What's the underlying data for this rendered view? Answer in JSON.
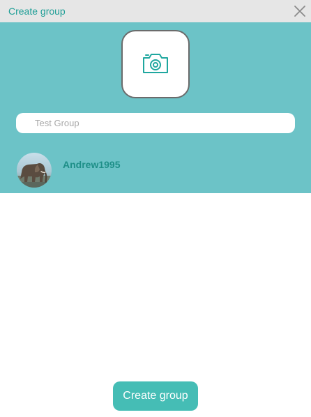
{
  "window": {
    "title": "Create group",
    "close_icon": "close-icon"
  },
  "group": {
    "photo_icon": "camera-icon",
    "name_placeholder": "Test Group",
    "name_value": ""
  },
  "members": [
    {
      "name": "Andrew1995",
      "avatar_icon": "elephant-avatar"
    }
  ],
  "actions": {
    "create_label": "Create group"
  },
  "colors": {
    "header_background": "#e6e6e6",
    "title_text": "#1e9e96",
    "panel_background": "#6cc3c7",
    "member_name_text": "#1e8f88",
    "button_background": "#45bdb5",
    "button_text": "#ffffff"
  }
}
